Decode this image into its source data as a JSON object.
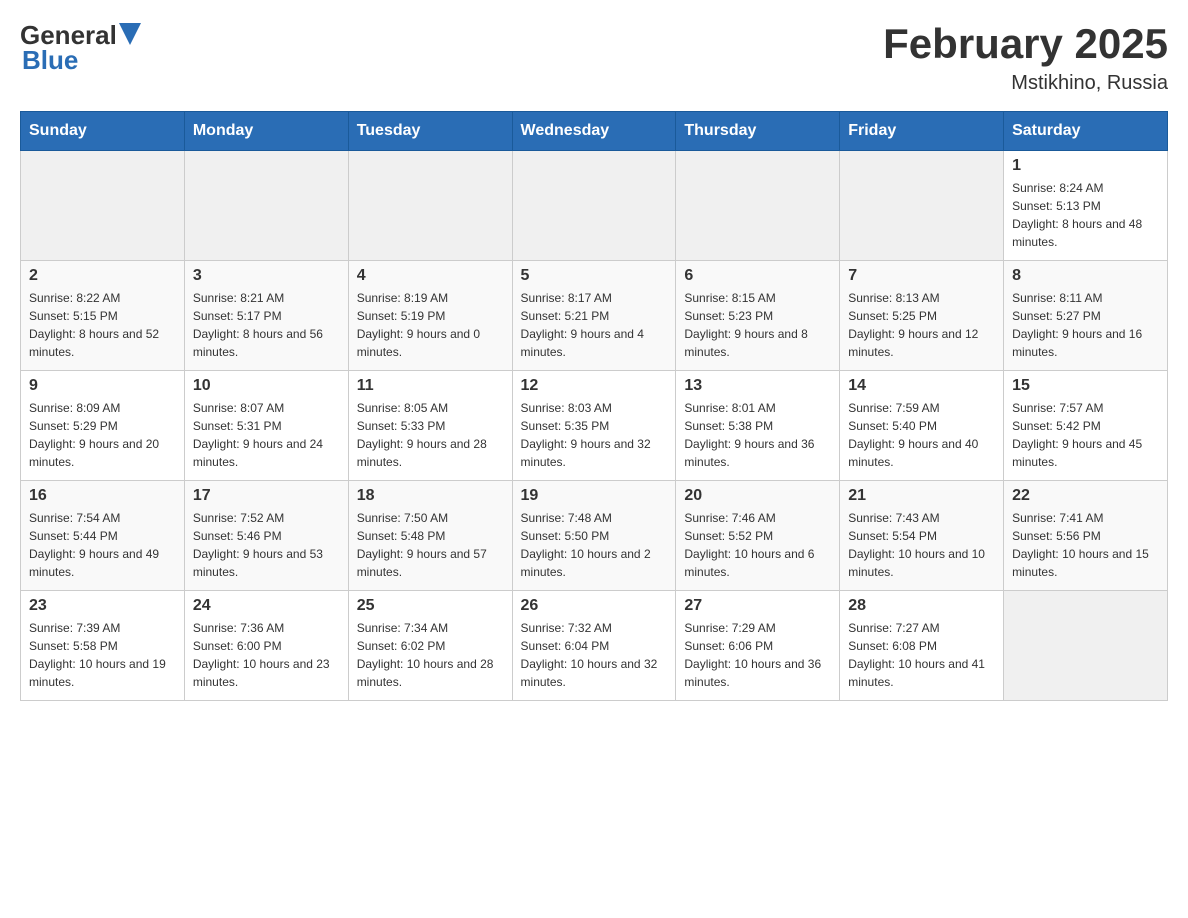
{
  "logo": {
    "general": "General",
    "blue": "Blue"
  },
  "title": {
    "month": "February 2025",
    "location": "Mstikhino, Russia"
  },
  "weekdays": [
    "Sunday",
    "Monday",
    "Tuesday",
    "Wednesday",
    "Thursday",
    "Friday",
    "Saturday"
  ],
  "weeks": [
    [
      {
        "day": "",
        "info": ""
      },
      {
        "day": "",
        "info": ""
      },
      {
        "day": "",
        "info": ""
      },
      {
        "day": "",
        "info": ""
      },
      {
        "day": "",
        "info": ""
      },
      {
        "day": "",
        "info": ""
      },
      {
        "day": "1",
        "info": "Sunrise: 8:24 AM\nSunset: 5:13 PM\nDaylight: 8 hours and 48 minutes."
      }
    ],
    [
      {
        "day": "2",
        "info": "Sunrise: 8:22 AM\nSunset: 5:15 PM\nDaylight: 8 hours and 52 minutes."
      },
      {
        "day": "3",
        "info": "Sunrise: 8:21 AM\nSunset: 5:17 PM\nDaylight: 8 hours and 56 minutes."
      },
      {
        "day": "4",
        "info": "Sunrise: 8:19 AM\nSunset: 5:19 PM\nDaylight: 9 hours and 0 minutes."
      },
      {
        "day": "5",
        "info": "Sunrise: 8:17 AM\nSunset: 5:21 PM\nDaylight: 9 hours and 4 minutes."
      },
      {
        "day": "6",
        "info": "Sunrise: 8:15 AM\nSunset: 5:23 PM\nDaylight: 9 hours and 8 minutes."
      },
      {
        "day": "7",
        "info": "Sunrise: 8:13 AM\nSunset: 5:25 PM\nDaylight: 9 hours and 12 minutes."
      },
      {
        "day": "8",
        "info": "Sunrise: 8:11 AM\nSunset: 5:27 PM\nDaylight: 9 hours and 16 minutes."
      }
    ],
    [
      {
        "day": "9",
        "info": "Sunrise: 8:09 AM\nSunset: 5:29 PM\nDaylight: 9 hours and 20 minutes."
      },
      {
        "day": "10",
        "info": "Sunrise: 8:07 AM\nSunset: 5:31 PM\nDaylight: 9 hours and 24 minutes."
      },
      {
        "day": "11",
        "info": "Sunrise: 8:05 AM\nSunset: 5:33 PM\nDaylight: 9 hours and 28 minutes."
      },
      {
        "day": "12",
        "info": "Sunrise: 8:03 AM\nSunset: 5:35 PM\nDaylight: 9 hours and 32 minutes."
      },
      {
        "day": "13",
        "info": "Sunrise: 8:01 AM\nSunset: 5:38 PM\nDaylight: 9 hours and 36 minutes."
      },
      {
        "day": "14",
        "info": "Sunrise: 7:59 AM\nSunset: 5:40 PM\nDaylight: 9 hours and 40 minutes."
      },
      {
        "day": "15",
        "info": "Sunrise: 7:57 AM\nSunset: 5:42 PM\nDaylight: 9 hours and 45 minutes."
      }
    ],
    [
      {
        "day": "16",
        "info": "Sunrise: 7:54 AM\nSunset: 5:44 PM\nDaylight: 9 hours and 49 minutes."
      },
      {
        "day": "17",
        "info": "Sunrise: 7:52 AM\nSunset: 5:46 PM\nDaylight: 9 hours and 53 minutes."
      },
      {
        "day": "18",
        "info": "Sunrise: 7:50 AM\nSunset: 5:48 PM\nDaylight: 9 hours and 57 minutes."
      },
      {
        "day": "19",
        "info": "Sunrise: 7:48 AM\nSunset: 5:50 PM\nDaylight: 10 hours and 2 minutes."
      },
      {
        "day": "20",
        "info": "Sunrise: 7:46 AM\nSunset: 5:52 PM\nDaylight: 10 hours and 6 minutes."
      },
      {
        "day": "21",
        "info": "Sunrise: 7:43 AM\nSunset: 5:54 PM\nDaylight: 10 hours and 10 minutes."
      },
      {
        "day": "22",
        "info": "Sunrise: 7:41 AM\nSunset: 5:56 PM\nDaylight: 10 hours and 15 minutes."
      }
    ],
    [
      {
        "day": "23",
        "info": "Sunrise: 7:39 AM\nSunset: 5:58 PM\nDaylight: 10 hours and 19 minutes."
      },
      {
        "day": "24",
        "info": "Sunrise: 7:36 AM\nSunset: 6:00 PM\nDaylight: 10 hours and 23 minutes."
      },
      {
        "day": "25",
        "info": "Sunrise: 7:34 AM\nSunset: 6:02 PM\nDaylight: 10 hours and 28 minutes."
      },
      {
        "day": "26",
        "info": "Sunrise: 7:32 AM\nSunset: 6:04 PM\nDaylight: 10 hours and 32 minutes."
      },
      {
        "day": "27",
        "info": "Sunrise: 7:29 AM\nSunset: 6:06 PM\nDaylight: 10 hours and 36 minutes."
      },
      {
        "day": "28",
        "info": "Sunrise: 7:27 AM\nSunset: 6:08 PM\nDaylight: 10 hours and 41 minutes."
      },
      {
        "day": "",
        "info": ""
      }
    ]
  ]
}
